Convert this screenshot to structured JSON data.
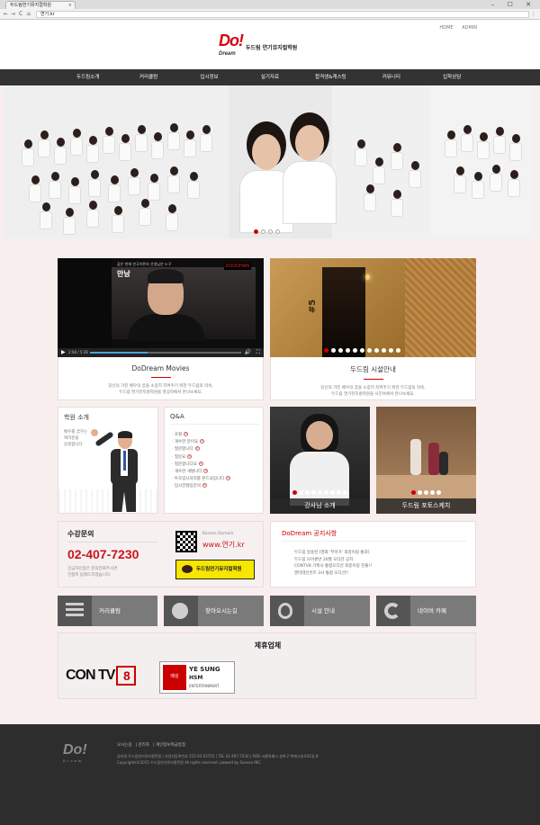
{
  "browser": {
    "tab_title": "두드림연기뮤지컬학원",
    "url": "연기.kr",
    "back": "←",
    "forward": "→",
    "reload": "C",
    "home": "⌂",
    "window_controls": "–  ☐  ✕",
    "menu": "⋮"
  },
  "header": {
    "toplinks": [
      "HOME",
      "ADMIN"
    ],
    "logo_mark": "Do!",
    "logo_sub": "Dream",
    "logo_text": "두드림 연기뮤지컬학원"
  },
  "nav": [
    "두드림소개",
    "커리큘럼",
    "입시정보",
    "실기자료",
    "합격생&캐스팅",
    "커뮤니티",
    "입학상담"
  ],
  "hero": {
    "slide_count": 4,
    "active": 0
  },
  "movies": {
    "title": "DoDream Movies",
    "desc1": "당신의 가진 배우의 꿈을 소중히 지켜주기 위한 두드림의 약속,",
    "desc2": "두드림 연기뮤지컬학원을 영상하에서 만나보세요.",
    "video_title": "만남",
    "video_caption": "꿈은 현재 연극이론의 선생님은 누구",
    "video_brand": "DODOHAN",
    "time": "2:08 / 5:28",
    "progress": 0.38,
    "play": "▶",
    "volume": "🔊",
    "fullscreen": "⛶"
  },
  "facility": {
    "title": "두드림 시설안내",
    "desc1": "당신의 가진 배우의 꿈을 소중히 지켜주기 위한 두드림의 약속,",
    "desc2": "두드림 연기뮤지컬학원을 사진속에서 만나보세요.",
    "room_number": "#5",
    "dots": 11,
    "active": 0
  },
  "intro": {
    "title": "학원 소개",
    "line1": "배우를 꿈꾸는",
    "line2": "여러분을",
    "line3": "응원합니다"
  },
  "qa": {
    "title": "Q&A",
    "items": [
      "초철",
      "개수한 분이요",
      "질문합니다",
      "질문요",
      "질문합니다요",
      "개수한 개벌니다",
      "투호입시처리를 본드요입니다",
      "입시전형입문의"
    ]
  },
  "teacher": {
    "caption": "강사님 소개",
    "dots": 9,
    "active": 0
  },
  "forcesketch": {
    "caption": "두드림 포토스케치",
    "dots": 5,
    "active": 0
  },
  "contact": {
    "title": "수강문의",
    "phone": "02-407-7230",
    "sub1": "궁금하신점은 문의전화주시면",
    "sub2": "친절히 답해드리겠습니다.",
    "domain_label": "Korean Domain",
    "domain": "www.연기.kr",
    "kakao": "두드림연기뮤지컬학원"
  },
  "notice": {
    "title": "DoDream 공지사항",
    "items": [
      "두드림 방송된 [영화 '무아가' 최종이링 통과]",
      "두드림 모이센반 20월 오디션 공지",
      "CONTV8 기획사 통합오디션 최종이링 진출!!",
      "엔터테인먼트 3사 통합 오디션!!"
    ]
  },
  "quick": [
    "커리큘럼",
    "찾아오시는길",
    "시설 안내",
    "네이버 카페"
  ],
  "partners": {
    "title": "제휴업체",
    "contv": "CON TV",
    "contv_num": "8",
    "seal": "예성",
    "yesung1": "YE SUNG",
    "yesung2": "HSM",
    "yesung3": "ENTERTAINMENT"
  },
  "footer": {
    "logo": "Do!",
    "logo_sub": "Dream",
    "links": [
      "오시는길",
      "관리자",
      "개인정보취급방침"
    ],
    "line1": "상호명 두드림연기뮤지컬학원 | 사업자등록번호 215-93-05725 | TEL 02-407-7230 | ADD 서울특별시 송파구 백제고분로41길 8",
    "line2": "Copyrights©2015 두드림연기뮤지컬학원 All rights reserved. powerd by Sonsoo INC."
  }
}
